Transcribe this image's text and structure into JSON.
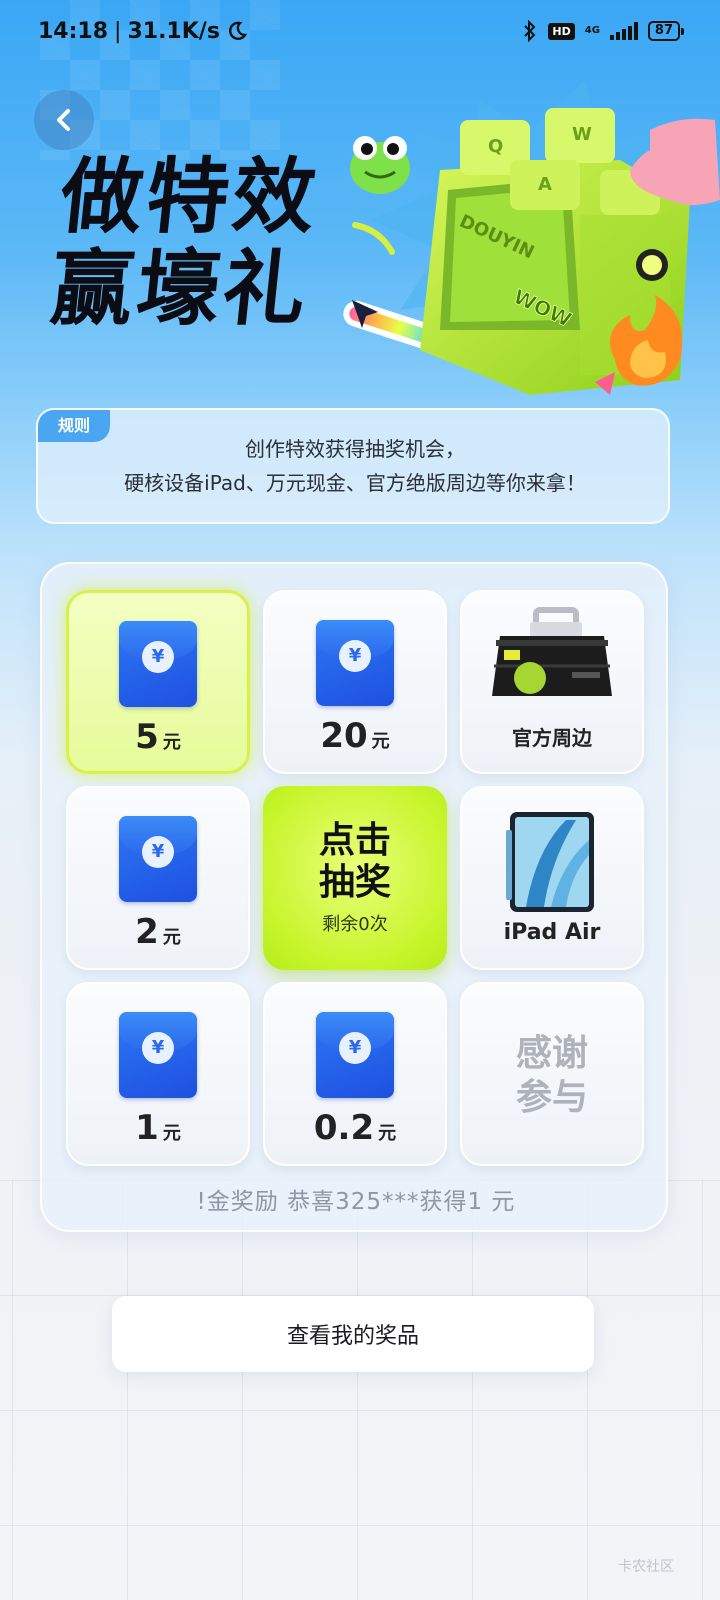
{
  "status_bar": {
    "time": "14:18",
    "network_speed": "31.1K/s",
    "hd_label": "HD",
    "network_type": "4G",
    "battery": "87"
  },
  "header": {
    "back_icon": "chevron-left-icon",
    "title_line1": "做特效",
    "title_line2": "赢壕礼"
  },
  "hero_art": {
    "brand_text": "DOUYIN",
    "sticker_text": "WOW"
  },
  "rules": {
    "tag": "规则",
    "line1": "创作特效获得抽奖机会，",
    "line2": "硬核设备iPad、万元现金、官方绝版周边等你来拿！"
  },
  "board": {
    "cells": [
      {
        "type": "cash",
        "value": "5",
        "unit": "元",
        "icon": "red-envelope-icon",
        "currency": "¥"
      },
      {
        "type": "cash",
        "value": "20",
        "unit": "元",
        "icon": "red-envelope-icon",
        "currency": "¥"
      },
      {
        "type": "prize",
        "label": "官方周边",
        "icon": "merch-box-icon"
      },
      {
        "type": "cash",
        "value": "2",
        "unit": "元",
        "icon": "red-envelope-icon",
        "currency": "¥"
      },
      {
        "type": "draw",
        "label": "点击抽奖",
        "sub": "剩余0次"
      },
      {
        "type": "prize",
        "label": "iPad Air",
        "icon": "ipad-icon"
      },
      {
        "type": "cash",
        "value": "1",
        "unit": "元",
        "icon": "red-envelope-icon",
        "currency": "¥"
      },
      {
        "type": "cash",
        "value": "0.2",
        "unit": "元",
        "icon": "red-envelope-icon",
        "currency": "¥"
      },
      {
        "type": "none",
        "label": "感谢参与"
      }
    ],
    "ticker": "!金奖励   恭喜325***获得1 元"
  },
  "prizes_button": "查看我的奖品",
  "watermark": "卡农社区",
  "colors": {
    "accent_lime": "#c7f52c",
    "envelope_blue": "#1e50e0",
    "rules_tag": "#4aa6f0"
  }
}
